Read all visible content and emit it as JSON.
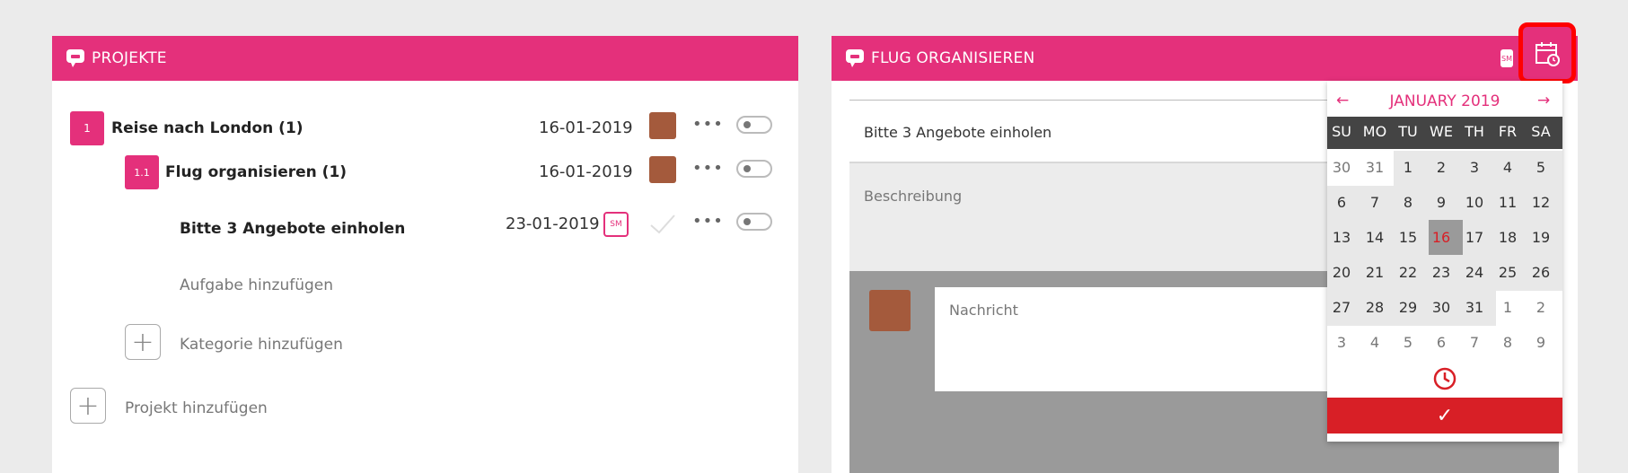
{
  "left_panel": {
    "title": "PROJEKTE",
    "rows": [
      {
        "badge": "1",
        "title": "Reise nach London (1)",
        "date": "16-01-2019"
      },
      {
        "badge": "1.1",
        "title": "Flug organisieren (1)",
        "date": "16-01-2019"
      },
      {
        "title": "Bitte 3 Angebote einholen",
        "date": "23-01-2019",
        "assignee": "SM"
      }
    ],
    "add_task": "Aufgabe hinzufügen",
    "add_category": "Kategorie hinzufügen",
    "add_project": "Projekt hinzufügen",
    "more": "•••"
  },
  "right_panel": {
    "title": "FLUG ORGANISIEREN",
    "header_badge": "SM",
    "task": "Bitte 3 Angebote einholen",
    "description_placeholder": "Beschreibung",
    "message_placeholder": "Nachricht"
  },
  "calendar": {
    "prev": "←",
    "next": "→",
    "month_label": "JANUARY 2019",
    "weekdays": [
      "SU",
      "MO",
      "TU",
      "WE",
      "TH",
      "FR",
      "SA"
    ],
    "weeks": [
      [
        "30",
        "31",
        "1",
        "2",
        "3",
        "4",
        "5"
      ],
      [
        "6",
        "7",
        "8",
        "9",
        "10",
        "11",
        "12"
      ],
      [
        "13",
        "14",
        "15",
        "16",
        "17",
        "18",
        "19"
      ],
      [
        "20",
        "21",
        "22",
        "23",
        "24",
        "25",
        "26"
      ],
      [
        "27",
        "28",
        "29",
        "30",
        "31",
        "1",
        "2"
      ],
      [
        "3",
        "4",
        "5",
        "6",
        "7",
        "8",
        "9"
      ]
    ],
    "selected_day": "16",
    "confirm": "✓"
  },
  "colors": {
    "accent": "#e4307b",
    "confirm": "#d81f26",
    "highlight": "#ff0000"
  },
  "icons": [
    "chat-icon",
    "calendar-clock-icon",
    "clock-icon",
    "check-icon",
    "plus-icon"
  ]
}
